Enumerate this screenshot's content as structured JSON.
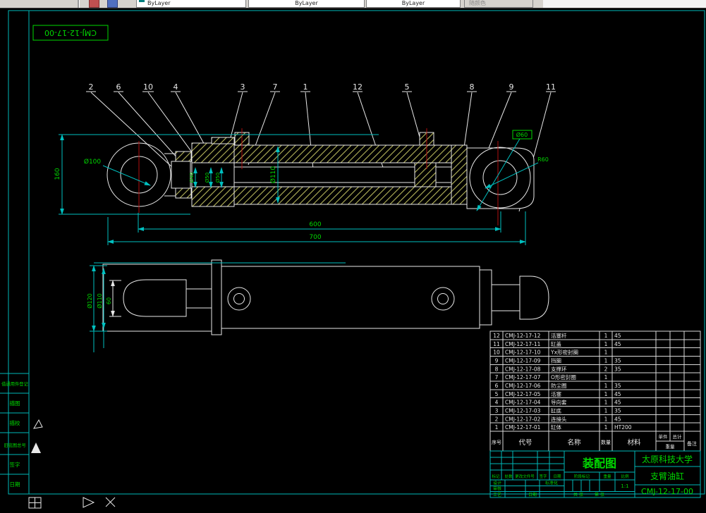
{
  "toolbar": {
    "color_control": "ByLayer",
    "linetype_control": "ByLayer",
    "lineweight_control": "ByLayer",
    "plotstyle_control": "随颜色"
  },
  "id_box": "CMJ-12-17-00",
  "balloons": [
    "2",
    "6",
    "10",
    "4",
    "3",
    "7",
    "1",
    "12",
    "5",
    "8",
    "9",
    "11"
  ],
  "dims": {
    "eye_hole": "Ø100",
    "eye_width": "160",
    "seal1": "Ø40",
    "seal2": "Ø50",
    "seal3": "Ø50",
    "bore": "Ø110",
    "rod_eye_hole": "Ø60",
    "rod_eye_radius": "R60",
    "len_inner": "600",
    "len_total": "700",
    "bv_od": "Ø120",
    "bv_id": "Ø110",
    "bv_w": "60"
  },
  "left_margin": {
    "items": [
      "借通用件登记",
      "描图",
      "描校",
      "旧底图总号",
      "签字",
      "日期"
    ]
  },
  "parts_list": {
    "headers": {
      "no": "序号",
      "code": "代号",
      "name": "名称",
      "qty": "数量",
      "material": "材料",
      "unit": "单件",
      "total": "总计",
      "weight": "重量",
      "remark": "备注"
    },
    "rows": [
      [
        "12",
        "CMJ-12-17-12",
        "活塞杆",
        "1",
        "45"
      ],
      [
        "11",
        "CMJ-12-17-11",
        "缸盖",
        "1",
        "45"
      ],
      [
        "10",
        "CMJ-12-17-10",
        "Yx形密封圈",
        "1",
        ""
      ],
      [
        "9",
        "CMJ-12-17-09",
        "挡圈",
        "1",
        "35"
      ],
      [
        "8",
        "CMJ-12-17-08",
        "支撑环",
        "2",
        "35"
      ],
      [
        "7",
        "CMJ-12-17-07",
        "O形密封圈",
        "1",
        ""
      ],
      [
        "6",
        "CMJ-12-17-06",
        "防尘圈",
        "1",
        "35"
      ],
      [
        "5",
        "CMJ-12-17-05",
        "活塞",
        "1",
        "45"
      ],
      [
        "4",
        "CMJ-12-17-04",
        "导向套",
        "1",
        "45"
      ],
      [
        "3",
        "CMJ-12-17-03",
        "缸底",
        "1",
        "35"
      ],
      [
        "2",
        "CMJ-12-17-02",
        "连接头",
        "1",
        "45"
      ],
      [
        "1",
        "CMJ-12-17-01",
        "缸体",
        "1",
        "HT200"
      ]
    ]
  },
  "title_block": {
    "title": "装配图",
    "org": "太原科技大学",
    "product": "支臂油缸",
    "number": "CMJ-12-17-00",
    "labels": {
      "mark": "标记",
      "count": "处数",
      "change_doc": "更改文件号",
      "sign": "签字",
      "date": "日期",
      "design": "设计",
      "standardize": "标准化",
      "review": "审核",
      "process": "工艺",
      "process_date": "日期",
      "stage_mark": "阶段标记",
      "weight": "重量",
      "scale": "比例",
      "scale_value": "1:1",
      "sheet_total": "共 张",
      "sheet_no": "第 张"
    }
  }
}
